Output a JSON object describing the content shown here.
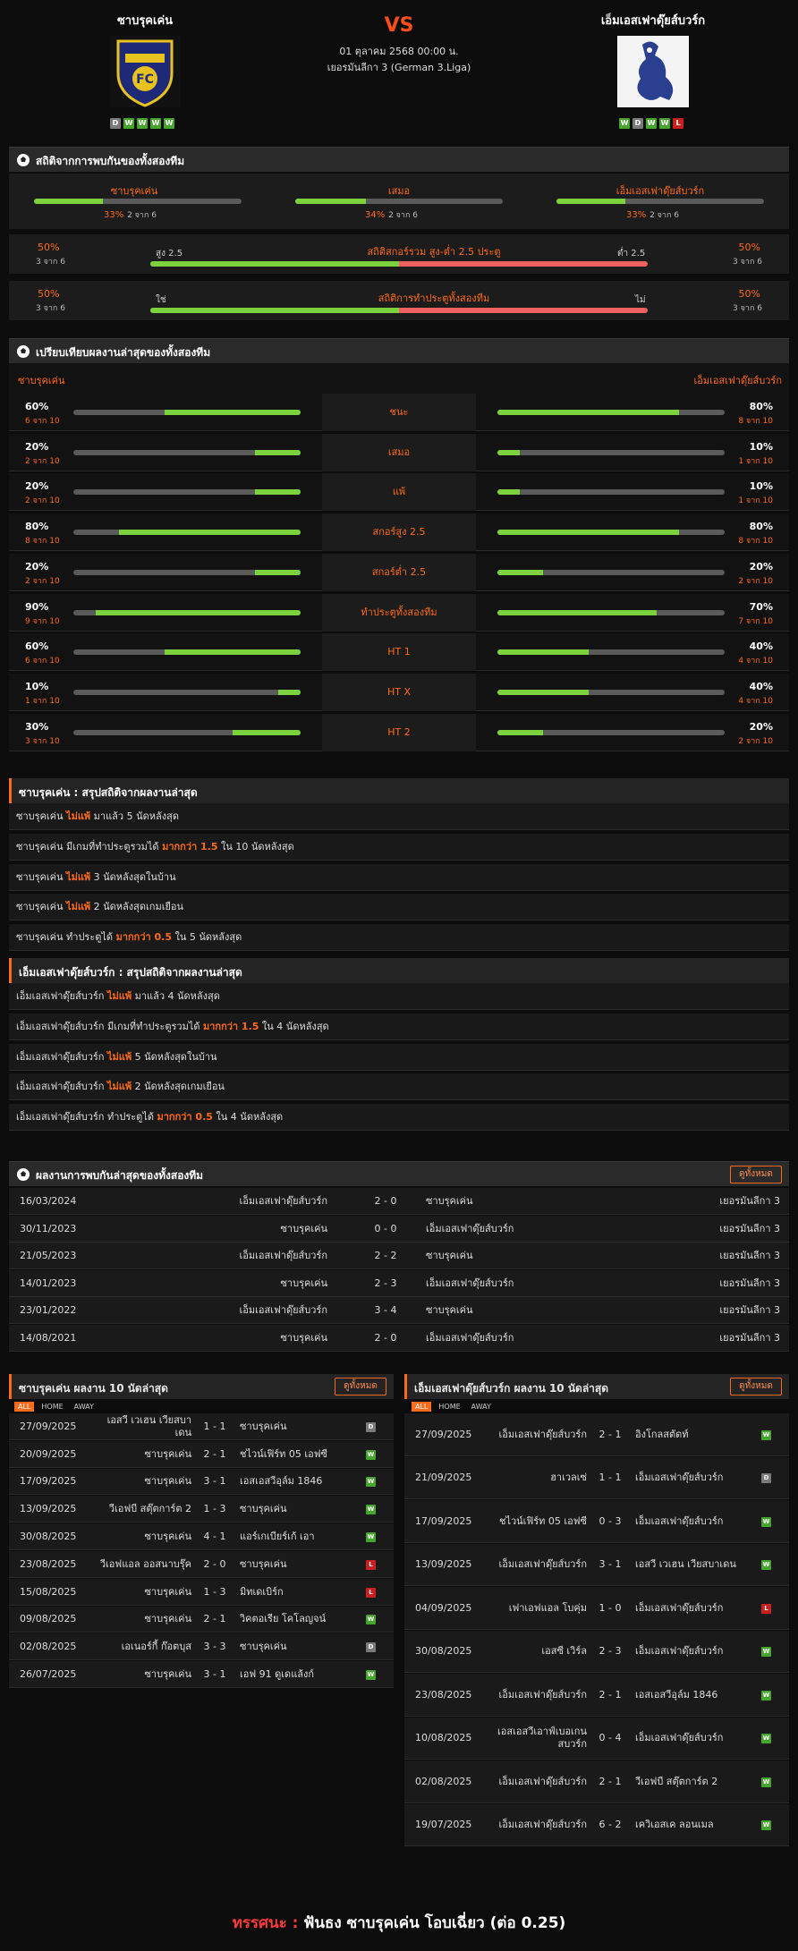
{
  "header": {
    "home": {
      "name": "ซาบรุคเค่น",
      "form": [
        "D",
        "W",
        "W",
        "W",
        "W"
      ]
    },
    "away": {
      "name": "เอ็มเอสเฟาดุ๊ยส์บวร์ก",
      "form": [
        "W",
        "D",
        "W",
        "W",
        "L"
      ]
    },
    "vs": "VS",
    "date": "01 ตุลาคม 2568 00:00 น.",
    "league": "เยอรมันลีกา 3 (German 3.Liga)"
  },
  "h2h_stats": {
    "title": "สถิติจากการพบกันของทั้งสองทีม",
    "cols": [
      {
        "label": "ซาบรุคเค่น",
        "pct": "33%",
        "sub": "2 จาก 6",
        "value": 0.33
      },
      {
        "label": "เสมอ",
        "pct": "34%",
        "sub": "2 จาก 6",
        "value": 0.34
      },
      {
        "label": "เอ็มเอสเฟาดุ๊ยส์บวร์ก",
        "pct": "33%",
        "sub": "2 จาก 6",
        "value": 0.33
      }
    ],
    "ou": {
      "title": "สถิติสกอร์รวม สูง-ต่ำ 2.5 ประตู",
      "left_pct": "50%",
      "left_sub": "3 จาก 6",
      "left_lbl": "สูง 2.5",
      "right_lbl": "ต่ำ 2.5",
      "right_pct": "50%",
      "right_sub": "3 จาก 6",
      "value": 0.5
    },
    "btts": {
      "title": "สถิติการทำประตูทั้งสองทีม",
      "left_pct": "50%",
      "left_sub": "3 จาก 6",
      "left_lbl": "ใช่",
      "right_lbl": "ไม่",
      "right_pct": "50%",
      "right_sub": "3 จาก 6",
      "value": 0.5
    }
  },
  "compare": {
    "title": "เปรียบเทียบผลงานล่าสุดของทั้งสองทีม",
    "home_label": "ซาบรุคเค่น",
    "away_label": "เอ็มเอสเฟาดุ๊ยส์บวร์ก",
    "rows": [
      {
        "label": "ชนะ",
        "hp": "60%",
        "hs": "6 จาก 10",
        "hv": 0.6,
        "ap": "80%",
        "as": "8 จาก 10",
        "av": 0.8
      },
      {
        "label": "เสมอ",
        "hp": "20%",
        "hs": "2 จาก 10",
        "hv": 0.2,
        "ap": "10%",
        "as": "1 จาก 10",
        "av": 0.1
      },
      {
        "label": "แพ้",
        "hp": "20%",
        "hs": "2 จาก 10",
        "hv": 0.2,
        "ap": "10%",
        "as": "1 จาก 10",
        "av": 0.1
      },
      {
        "label": "สกอร์สูง 2.5",
        "hp": "80%",
        "hs": "8 จาก 10",
        "hv": 0.8,
        "ap": "80%",
        "as": "8 จาก 10",
        "av": 0.8
      },
      {
        "label": "สกอร์ต่ำ 2.5",
        "hp": "20%",
        "hs": "2 จาก 10",
        "hv": 0.2,
        "ap": "20%",
        "as": "2 จาก 10",
        "av": 0.2
      },
      {
        "label": "ทำประตูทั้งสองทีม",
        "hp": "90%",
        "hs": "9 จาก 10",
        "hv": 0.9,
        "ap": "70%",
        "as": "7 จาก 10",
        "av": 0.7
      },
      {
        "label": "HT 1",
        "hp": "60%",
        "hs": "6 จาก 10",
        "hv": 0.6,
        "ap": "40%",
        "as": "4 จาก 10",
        "av": 0.4
      },
      {
        "label": "HT X",
        "hp": "10%",
        "hs": "1 จาก 10",
        "hv": 0.1,
        "ap": "40%",
        "as": "4 จาก 10",
        "av": 0.4
      },
      {
        "label": "HT 2",
        "hp": "30%",
        "hs": "3 จาก 10",
        "hv": 0.3,
        "ap": "20%",
        "as": "2 จาก 10",
        "av": 0.2
      }
    ]
  },
  "home_summary": {
    "title": "ซาบรุคเค่น : สรุปสถิติจากผลงานล่าสุด",
    "rows": [
      {
        "a": "ซาบรุคเค่น ",
        "b": "ไม่แพ้",
        "c": " มาแล้ว 5 นัดหลังสุด"
      },
      {
        "a": "ซาบรุคเค่น มีเกมที่ทำประตูรวมได้ ",
        "b": "มากกว่า 1.5",
        "c": " ใน 10 นัดหลังสุด"
      },
      {
        "a": "ซาบรุคเค่น ",
        "b": "ไม่แพ้",
        "c": " 3 นัดหลังสุดในบ้าน"
      },
      {
        "a": "ซาบรุคเค่น ",
        "b": "ไม่แพ้",
        "c": " 2 นัดหลังสุดเกมเยือน"
      },
      {
        "a": "ซาบรุคเค่น ทำประตูได้ ",
        "b": "มากกว่า 0.5",
        "c": " ใน 5 นัดหลังสุด"
      }
    ]
  },
  "away_summary": {
    "title": "เอ็มเอสเฟาดุ๊ยส์บวร์ก : สรุปสถิติจากผลงานล่าสุด",
    "rows": [
      {
        "a": "เอ็มเอสเฟาดุ๊ยส์บวร์ก ",
        "b": "ไม่แพ้",
        "c": " มาแล้ว 4 นัดหลังสุด"
      },
      {
        "a": "เอ็มเอสเฟาดุ๊ยส์บวร์ก มีเกมที่ทำประตูรวมได้ ",
        "b": "มากกว่า 1.5",
        "c": " ใน 4 นัดหลังสุด"
      },
      {
        "a": "เอ็มเอสเฟาดุ๊ยส์บวร์ก ",
        "b": "ไม่แพ้",
        "c": " 5 นัดหลังสุดในบ้าน"
      },
      {
        "a": "เอ็มเอสเฟาดุ๊ยส์บวร์ก ",
        "b": "ไม่แพ้",
        "c": " 2 นัดหลังสุดเกมเยือน"
      },
      {
        "a": "เอ็มเอสเฟาดุ๊ยส์บวร์ก ทำประตูได้ ",
        "b": "มากกว่า 0.5",
        "c": " ใน 4 นัดหลังสุด"
      }
    ]
  },
  "h2h_results": {
    "title": "ผลงานการพบกันล่าสุดของทั้งสองทีม",
    "view_all": "ดูทั้งหมด",
    "rows": [
      {
        "date": "16/03/2024",
        "home": "เอ็มเอสเฟาดุ๊ยส์บวร์ก",
        "score": "2 - 0",
        "away": "ซาบรุคเค่น",
        "league": "เยอรมันลีกา 3"
      },
      {
        "date": "30/11/2023",
        "home": "ซาบรุคเค่น",
        "score": "0 - 0",
        "away": "เอ็มเอสเฟาดุ๊ยส์บวร์ก",
        "league": "เยอรมันลีกา 3"
      },
      {
        "date": "21/05/2023",
        "home": "เอ็มเอสเฟาดุ๊ยส์บวร์ก",
        "score": "2 - 2",
        "away": "ซาบรุคเค่น",
        "league": "เยอรมันลีกา 3"
      },
      {
        "date": "14/01/2023",
        "home": "ซาบรุคเค่น",
        "score": "2 - 3",
        "away": "เอ็มเอสเฟาดุ๊ยส์บวร์ก",
        "league": "เยอรมันลีกา 3"
      },
      {
        "date": "23/01/2022",
        "home": "เอ็มเอสเฟาดุ๊ยส์บวร์ก",
        "score": "3 - 4",
        "away": "ซาบรุคเค่น",
        "league": "เยอรมันลีกา 3"
      },
      {
        "date": "14/08/2021",
        "home": "ซาบรุคเค่น",
        "score": "2 - 0",
        "away": "เอ็มเอสเฟาดุ๊ยส์บวร์ก",
        "league": "เยอรมันลีกา 3"
      }
    ]
  },
  "home_last10": {
    "title": "ซาบรุคเค่น ผลงาน 10 นัดล่าสุด",
    "view_all": "ดูทั้งหมด",
    "filters": [
      "ALL",
      "HOME",
      "AWAY"
    ],
    "rows": [
      {
        "date": "27/09/2025",
        "home": "เอสวี เวเฮน เวียสบาเดน",
        "score": "1 - 1",
        "away": "ซาบรุคเค่น",
        "r": "D"
      },
      {
        "date": "20/09/2025",
        "home": "ซาบรุคเค่น",
        "score": "2 - 1",
        "away": "ชไวน์เฟิร์ท 05 เอฟซี",
        "r": "W"
      },
      {
        "date": "17/09/2025",
        "home": "ซาบรุคเค่น",
        "score": "3 - 1",
        "away": "เอสเอสวีอุล์ม 1846",
        "r": "W"
      },
      {
        "date": "13/09/2025",
        "home": "วีเอฟบี สตุ๊ตการ์ต 2",
        "score": "1 - 3",
        "away": "ซาบรุคเค่น",
        "r": "W"
      },
      {
        "date": "30/08/2025",
        "home": "ซาบรุคเค่น",
        "score": "4 - 1",
        "away": "แอร์เกเบียร์เก้ เอา",
        "r": "W"
      },
      {
        "date": "23/08/2025",
        "home": "วีเอฟแอล ออสนาบรุ๊ค",
        "score": "2 - 0",
        "away": "ซาบรุคเค่น",
        "r": "L"
      },
      {
        "date": "15/08/2025",
        "home": "ซาบรุคเค่น",
        "score": "1 - 3",
        "away": "มิทเดเบิร์ก",
        "r": "L"
      },
      {
        "date": "09/08/2025",
        "home": "ซาบรุคเค่น",
        "score": "2 - 1",
        "away": "วิคตอเรีย โคโลญจน์",
        "r": "W"
      },
      {
        "date": "02/08/2025",
        "home": "เอเนอร์กี้ ก๊อตบุส",
        "score": "3 - 3",
        "away": "ซาบรุคเค่น",
        "r": "D"
      },
      {
        "date": "26/07/2025",
        "home": "ซาบรุคเค่น",
        "score": "3 - 1",
        "away": "เอฟ 91 ดูเดแล้งก์",
        "r": "W"
      }
    ]
  },
  "away_last10": {
    "title": "เอ็มเอสเฟาดุ๊ยส์บวร์ก ผลงาน 10 นัดล่าสุด",
    "view_all": "ดูทั้งหมด",
    "filters": [
      "ALL",
      "HOME",
      "AWAY"
    ],
    "rows": [
      {
        "date": "27/09/2025",
        "home": "เอ็มเอสเฟาดุ๊ยส์บวร์ก",
        "score": "2 - 1",
        "away": "อิงโกลสตัดท์",
        "r": "W"
      },
      {
        "date": "21/09/2025",
        "home": "ฮาเวลเซ่",
        "score": "1 - 1",
        "away": "เอ็มเอสเฟาดุ๊ยส์บวร์ก",
        "r": "D"
      },
      {
        "date": "17/09/2025",
        "home": "ชไวน์เฟิร์ท 05 เอฟซี",
        "score": "0 - 3",
        "away": "เอ็มเอสเฟาดุ๊ยส์บวร์ก",
        "r": "W"
      },
      {
        "date": "13/09/2025",
        "home": "เอ็มเอสเฟาดุ๊ยส์บวร์ก",
        "score": "3 - 1",
        "away": "เอสวี เวเฮน เวียสบาเดน",
        "r": "W"
      },
      {
        "date": "04/09/2025",
        "home": "เฟาเอฟแอล โบคุ่ม",
        "score": "1 - 0",
        "away": "เอ็มเอสเฟาดุ๊ยส์บวร์ก",
        "r": "L"
      },
      {
        "date": "30/08/2025",
        "home": "เอสซี เวิร์ล",
        "score": "2 - 3",
        "away": "เอ็มเอสเฟาดุ๊ยส์บวร์ก",
        "r": "W"
      },
      {
        "date": "23/08/2025",
        "home": "เอ็มเอสเฟาดุ๊ยส์บวร์ก",
        "score": "2 - 1",
        "away": "เอสเอสวีอุล์ม 1846",
        "r": "W"
      },
      {
        "date": "10/08/2025",
        "home": "เอสเอสวีเอาฟ์เบอเกนสบวร์ก",
        "score": "0 - 4",
        "away": "เอ็มเอสเฟาดุ๊ยส์บวร์ก",
        "r": "W"
      },
      {
        "date": "02/08/2025",
        "home": "เอ็มเอสเฟาดุ๊ยส์บวร์ก",
        "score": "2 - 1",
        "away": "วีเอฟบี สตุ๊ตการ์ต 2",
        "r": "W"
      },
      {
        "date": "19/07/2025",
        "home": "เอ็มเอสเฟาดุ๊ยส์บวร์ก",
        "score": "6 - 2",
        "away": "เควิเอสเค ลอนเมล",
        "r": "W"
      }
    ]
  },
  "verdict": {
    "label": "ทรรศนะ :",
    "text": " ฟันธง ซาบรุคเค่น โอบเฉี่ยว (ต่อ 0.25)"
  }
}
